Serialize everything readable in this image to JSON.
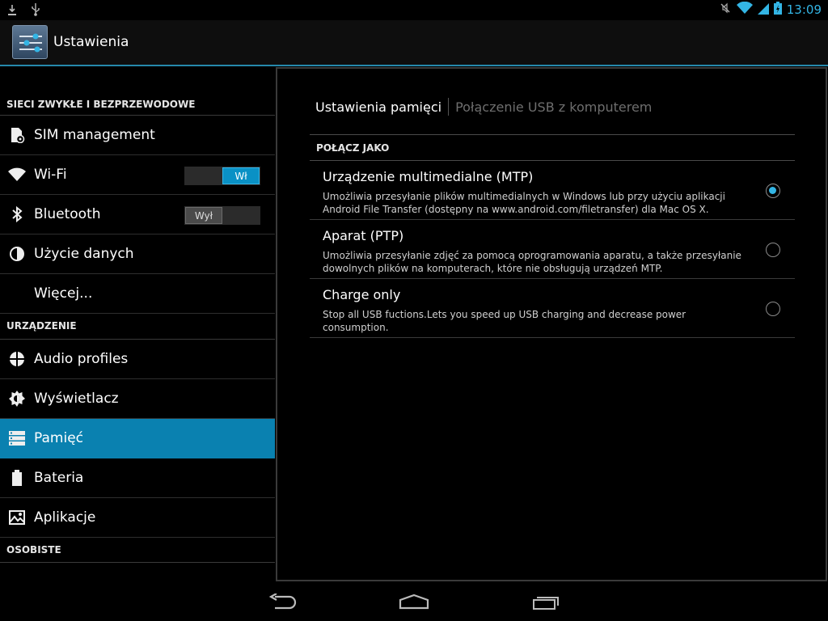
{
  "status_bar": {
    "left_icons": [
      "download-icon",
      "usb-icon"
    ],
    "right_icons": [
      "mute-icon",
      "wifi-icon",
      "signal-icon",
      "battery-charging-icon"
    ],
    "time": "13:09",
    "accent": "#33b5e5"
  },
  "action_bar": {
    "icon": "settings-sliders-icon",
    "title": "Ustawienia"
  },
  "sidebar": {
    "sections": [
      {
        "title": "SIECI ZWYKŁE I BEZPRZEWODOWE",
        "items": [
          {
            "label": "SIM management",
            "icon": "sim-settings-icon"
          },
          {
            "label": "Wi-Fi",
            "icon": "wifi-icon",
            "toggle": "Wł",
            "toggle_state": "on"
          },
          {
            "label": "Bluetooth",
            "icon": "bluetooth-icon",
            "toggle": "Wył",
            "toggle_state": "off"
          },
          {
            "label": "Użycie danych",
            "icon": "data-usage-icon"
          },
          {
            "label": "Więcej...",
            "icon": ""
          }
        ]
      },
      {
        "title": "URZĄDZENIE",
        "items": [
          {
            "label": "Audio profiles",
            "icon": "audio-profiles-icon"
          },
          {
            "label": "Wyświetlacz",
            "icon": "brightness-icon"
          },
          {
            "label": "Pamięć",
            "icon": "storage-icon",
            "active": true
          },
          {
            "label": "Bateria",
            "icon": "battery-icon"
          },
          {
            "label": "Aplikacje",
            "icon": "apps-icon"
          }
        ]
      },
      {
        "title": "OSOBISTE",
        "items": []
      }
    ],
    "active_color": "#0a81b0"
  },
  "main": {
    "tabs": [
      {
        "label": "Ustawienia pamięci",
        "active": true
      },
      {
        "label": "Połączenie USB z komputerem",
        "active": false
      }
    ],
    "section_title": "POŁĄCZ JAKO",
    "options": [
      {
        "title": "Urządzenie multimedialne (MTP)",
        "description": "Umożliwia przesyłanie plików multimedialnych w Windows lub przy użyciu aplikacji Android File Transfer (dostępny na www.android.com/filetransfer) dla Mac OS X.",
        "checked": true
      },
      {
        "title": "Aparat (PTP)",
        "description": "Umożliwia przesyłanie zdjęć za pomocą oprogramowania aparatu, a także przesyłanie dowolnych plików na komputerach, które nie obsługują urządzeń MTP.",
        "checked": false
      },
      {
        "title": "Charge only",
        "description": "Stop all USB fuctions.Lets you speed up USB charging and decrease power consumption.",
        "checked": false
      }
    ]
  },
  "nav_bar": {
    "buttons": [
      "back-icon",
      "home-icon",
      "recent-apps-icon"
    ]
  }
}
